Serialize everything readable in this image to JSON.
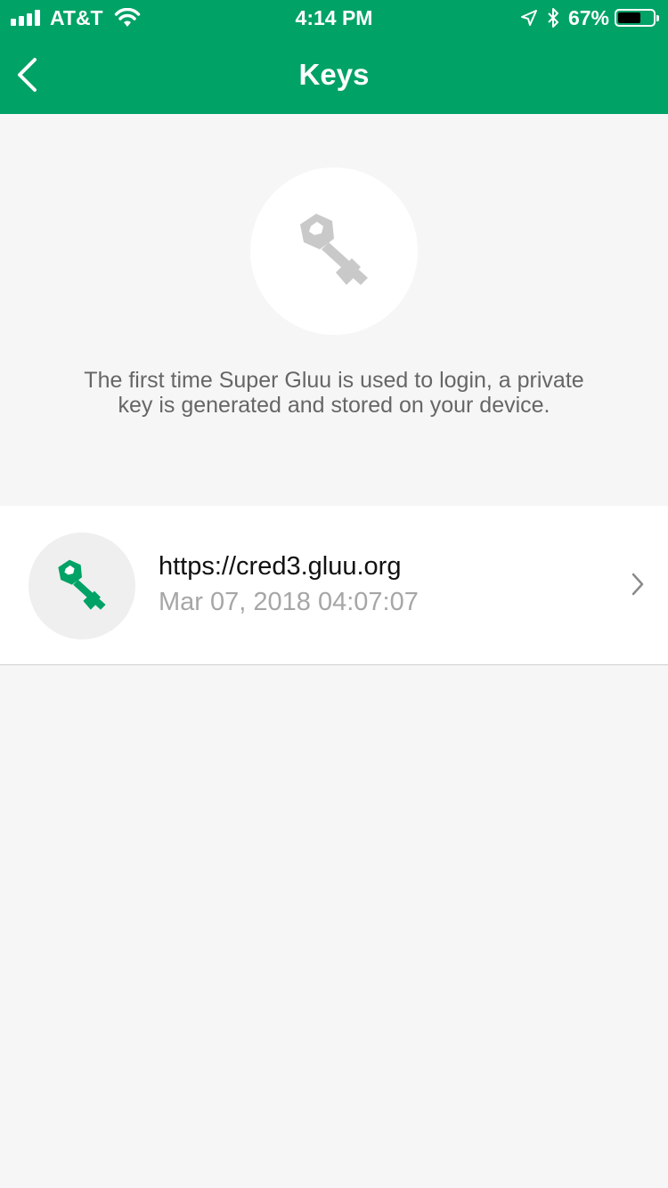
{
  "status_bar": {
    "carrier": "AT&T",
    "time": "4:14 PM",
    "battery_percent": "67%",
    "battery_level": 0.67,
    "icons": [
      "signal-icon",
      "wifi-icon",
      "location-icon",
      "bluetooth-icon",
      "battery-icon"
    ]
  },
  "nav": {
    "title": "Keys",
    "back_icon": "chevron-left-icon"
  },
  "info": {
    "icon": "key-icon",
    "description": "The first time Super Gluu is used to login, a private key is generated and stored on your device."
  },
  "keys": [
    {
      "url": "https://cred3.gluu.org",
      "date": "Mar 07, 2018 04:07:07",
      "icon": "key-icon"
    }
  ],
  "colors": {
    "brand_green": "#00a266",
    "background": "#f6f6f6",
    "icon_gray": "#c9c9c9",
    "key_green": "#00a266"
  }
}
